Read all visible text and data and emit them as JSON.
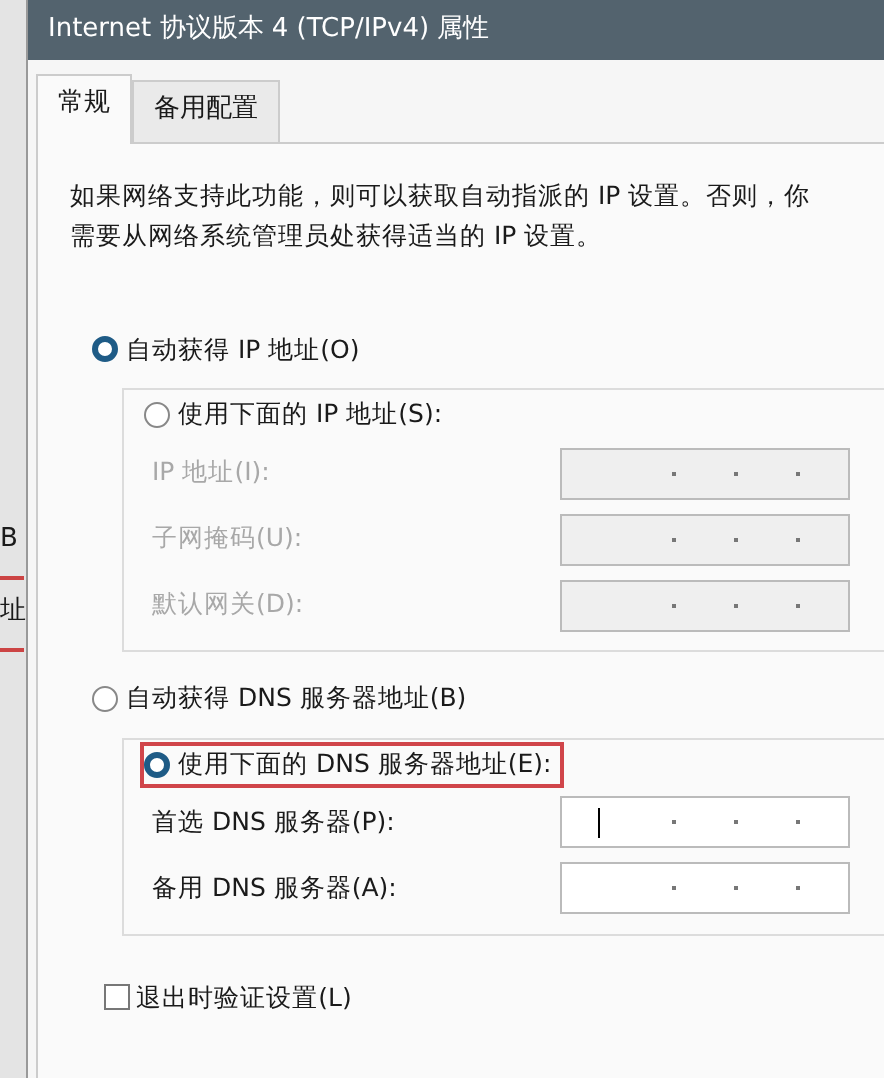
{
  "window": {
    "title": "Internet 协议版本 4 (TCP/IPv4) 属性"
  },
  "background_window": {
    "texts": [
      "B",
      "址"
    ]
  },
  "tabs": [
    {
      "label": "常规",
      "selected": true
    },
    {
      "label": "备用配置",
      "selected": false
    }
  ],
  "description": "如果网络支持此功能，则可以获取自动指派的 IP 设置。否则，你需要从网络系统管理员处获得适当的 IP 设置。",
  "ip_options": [
    {
      "label": "自动获得 IP 地址(O)",
      "selected": true
    },
    {
      "label": "使用下面的 IP 地址(S):",
      "selected": false
    }
  ],
  "ip_fields": [
    {
      "label": "IP 地址(I):",
      "disabled": true,
      "focused": false
    },
    {
      "label": "子网掩码(U):",
      "disabled": true,
      "focused": false
    },
    {
      "label": "默认网关(D):",
      "disabled": true,
      "focused": false
    }
  ],
  "dns_options": [
    {
      "label": "自动获得 DNS 服务器地址(B)",
      "selected": false,
      "highlighted": false
    },
    {
      "label": "使用下面的 DNS 服务器地址(E):",
      "selected": true,
      "highlighted": true
    }
  ],
  "dns_fields": [
    {
      "label": "首选 DNS 服务器(P):",
      "disabled": false,
      "focused": true
    },
    {
      "label": "备用 DNS 服务器(A):",
      "disabled": false,
      "focused": false
    }
  ],
  "validate_checkbox": {
    "label": "退出时验证设置(L)",
    "checked": false
  }
}
